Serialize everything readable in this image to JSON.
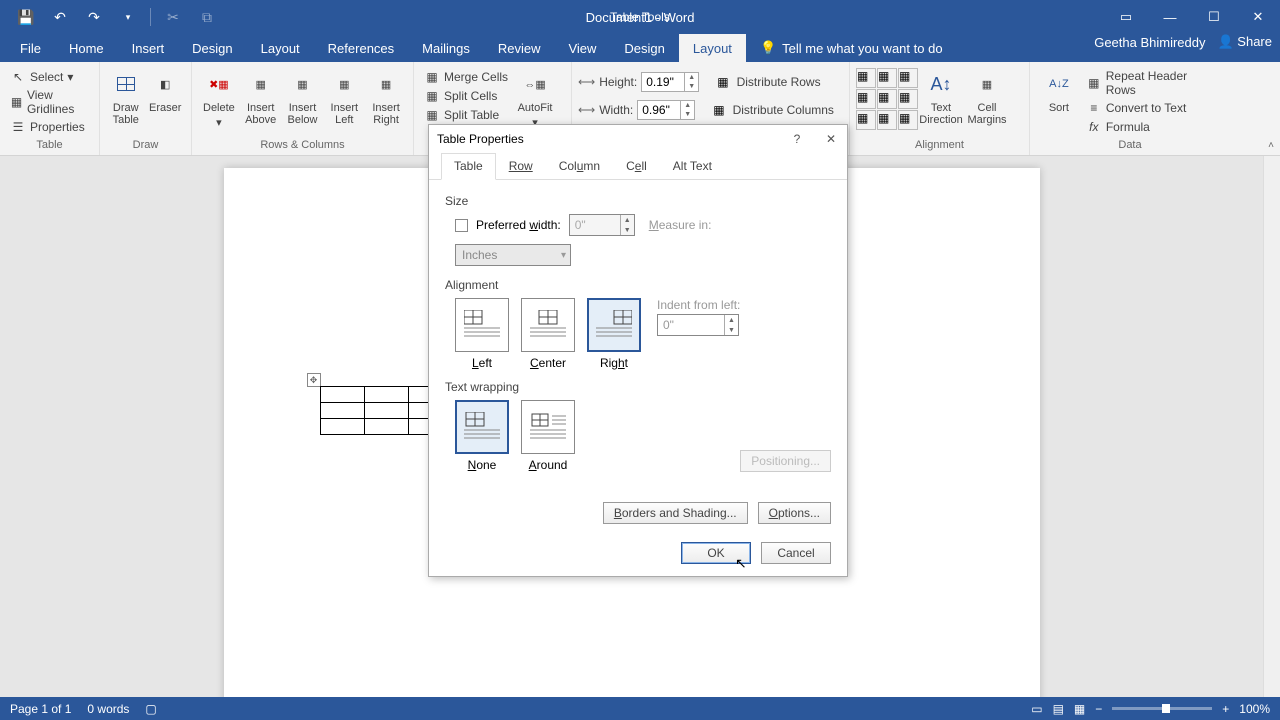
{
  "titlebar": {
    "doc_title": "Document1 - Word",
    "context_tool": "Table Tools"
  },
  "tabs": {
    "file": "File",
    "home": "Home",
    "insert": "Insert",
    "design": "Design",
    "layout": "Layout",
    "references": "References",
    "mailings": "Mailings",
    "review": "Review",
    "view": "View",
    "ctx_design": "Design",
    "ctx_layout": "Layout",
    "tell_me": "Tell me what you want to do"
  },
  "user": {
    "name": "Geetha Bhimireddy",
    "share": "Share"
  },
  "ribbon": {
    "table": {
      "select": "Select",
      "gridlines": "View Gridlines",
      "properties": "Properties",
      "group": "Table"
    },
    "draw": {
      "draw": "Draw Table",
      "eraser": "Eraser",
      "group": "Draw"
    },
    "rowscols": {
      "delete": "Delete",
      "ins_above": "Insert Above",
      "ins_below": "Insert Below",
      "ins_left": "Insert Left",
      "ins_right": "Insert Right",
      "group": "Rows & Columns"
    },
    "merge": {
      "merge": "Merge Cells",
      "split": "Split Cells",
      "split_table": "Split Table",
      "autofit": "AutoFit"
    },
    "size": {
      "height_label": "Height:",
      "height_val": "0.19\"",
      "width_label": "Width:",
      "width_val": "0.96\"",
      "dist_rows": "Distribute Rows",
      "dist_cols": "Distribute Columns"
    },
    "alignment": {
      "text_dir": "Text Direction",
      "cell_margins": "Cell Margins",
      "group": "Alignment"
    },
    "data": {
      "sort": "Sort",
      "repeat": "Repeat Header Rows",
      "convert": "Convert to Text",
      "formula": "Formula",
      "group": "Data"
    }
  },
  "dialog": {
    "title": "Table Properties",
    "tabs": {
      "table": "Table",
      "row": "Row",
      "column": "Column",
      "cell": "Cell",
      "alttext": "Alt Text"
    },
    "size_label": "Size",
    "pref_width": "Preferred width:",
    "pref_width_val": "0\"",
    "measure_in": "Measure in:",
    "measure_unit": "Inches",
    "alignment_label": "Alignment",
    "align": {
      "left": "Left",
      "center": "Center",
      "right": "Right"
    },
    "indent_label": "Indent from left:",
    "indent_val": "0\"",
    "wrap_label": "Text wrapping",
    "wrap": {
      "none": "None",
      "around": "Around"
    },
    "positioning": "Positioning...",
    "borders": "Borders and Shading...",
    "options": "Options...",
    "ok": "OK",
    "cancel": "Cancel"
  },
  "status": {
    "page": "Page 1 of 1",
    "words": "0 words",
    "zoom": "100%"
  }
}
